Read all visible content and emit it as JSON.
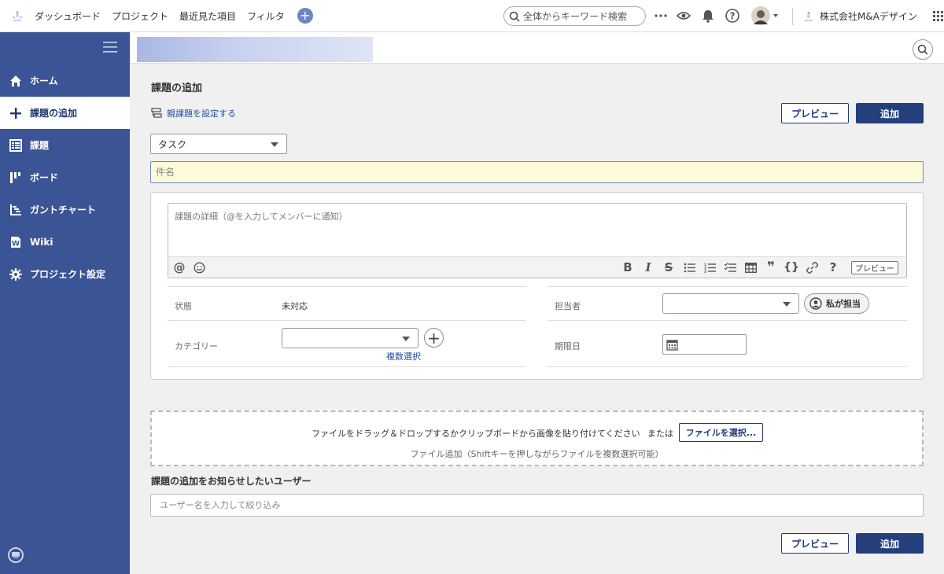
{
  "topbar": {
    "nav": [
      "ダッシュボード",
      "プロジェクト",
      "最近見た項目",
      "フィルタ"
    ],
    "search_placeholder": "全体からキーワード検索",
    "company": "株式会社M&Aデザイン"
  },
  "sidebar": {
    "items": [
      {
        "label": "ホーム",
        "icon": "home-icon"
      },
      {
        "label": "課題の追加",
        "icon": "plus-icon"
      },
      {
        "label": "課題",
        "icon": "list-icon"
      },
      {
        "label": "ボード",
        "icon": "board-icon"
      },
      {
        "label": "ガントチャート",
        "icon": "gantt-icon"
      },
      {
        "label": "Wiki",
        "icon": "wiki-icon"
      },
      {
        "label": "プロジェクト設定",
        "icon": "gear-icon"
      }
    ],
    "active_index": 1
  },
  "main": {
    "title": "課題の追加",
    "parent_link": "親課題を設定する",
    "preview_label": "プレビュー",
    "add_label": "追加",
    "issue_type": "タスク",
    "subject_placeholder": "件名",
    "description_placeholder": "課題の詳細（@を入力してメンバーに通知）",
    "toolbar_preview": "プレビュー",
    "fields": {
      "status_label": "状態",
      "status_value": "未対応",
      "assignee_label": "担当者",
      "assign_me": "私が担当",
      "category_label": "カテゴリー",
      "multi_select": "複数選択",
      "due_label": "期限日"
    },
    "attach": {
      "text": "ファイルをドラッグ＆ドロップするかクリップボードから画像を貼り付けてください",
      "or": "または",
      "button": "ファイルを選択...",
      "sub": "ファイル追加（Shiftキーを押しながらファイルを複数選択可能）"
    },
    "notify_label": "課題の追加をお知らせしたいユーザー",
    "notify_placeholder": "ユーザー名を入力して絞り込み"
  },
  "colors": {
    "sidebar": "#3a5496",
    "primary": "#243f7b",
    "subject_bg": "#fcfad9"
  }
}
